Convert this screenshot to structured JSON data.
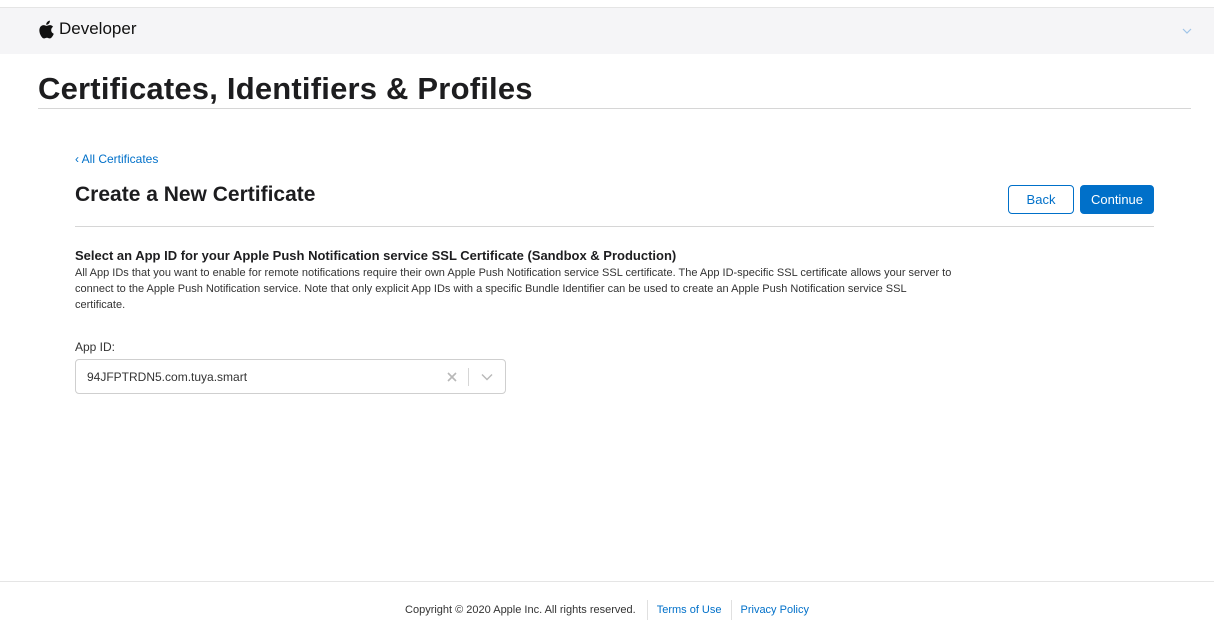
{
  "nav": {
    "brand_label": "Developer",
    "logo_icon": "apple-logo-icon",
    "menu_icon": "chevron-down-icon"
  },
  "page": {
    "title": "Certificates, Identifiers & Profiles"
  },
  "breadcrumb": {
    "back_link": "‹ All Certificates"
  },
  "section": {
    "title": "Create a New Certificate",
    "back_button": "Back",
    "continue_button": "Continue"
  },
  "form": {
    "heading": "Select an App ID for your Apple Push Notification service SSL Certificate (Sandbox & Production)",
    "description": "All App IDs that you want to enable for remote notifications require their own Apple Push Notification service SSL certificate. The App ID-specific SSL certificate allows your server to connect to the Apple Push Notification service. Note that only explicit App IDs with a specific Bundle Identifier can be used to create an Apple Push Notification service SSL certificate.",
    "app_id_label": "App ID:",
    "app_id_value": "94JFPTRDN5.com.tuya.smart",
    "clear_icon": "clear-icon",
    "dropdown_icon": "chevron-down-icon"
  },
  "footer": {
    "copyright": "Copyright © 2020 Apple Inc. All rights reserved.",
    "terms": "Terms of Use",
    "privacy": "Privacy Policy"
  },
  "colors": {
    "accent": "#0070c9",
    "nav_background": "#f5f5f7",
    "text": "#1d1d1f"
  }
}
